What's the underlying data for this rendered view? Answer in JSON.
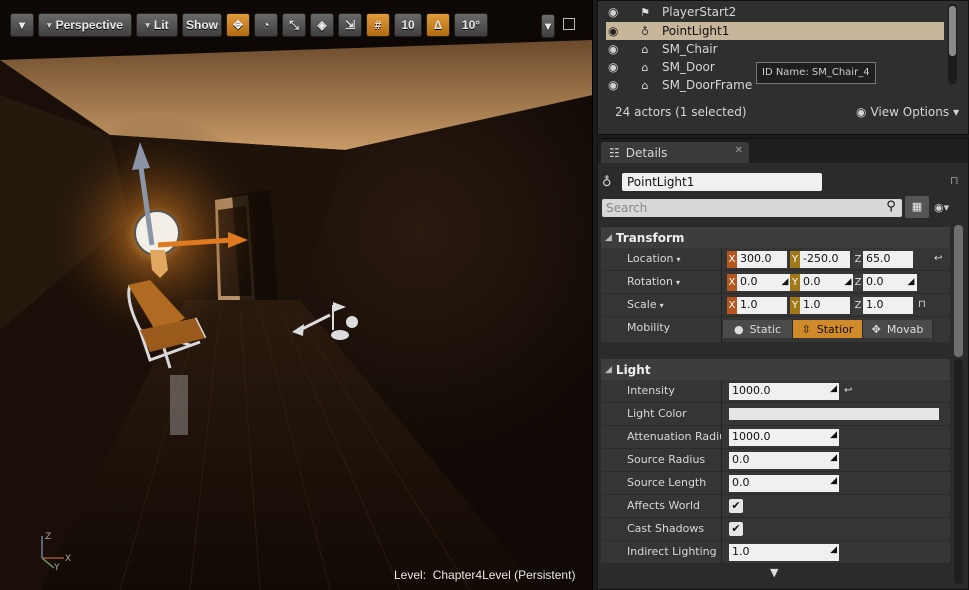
{
  "viewport": {
    "perspective_label": "Perspective",
    "lit_label": "Lit",
    "show_label": "Show",
    "grid_snap_value": "10",
    "rot_snap_value": "10°",
    "level_prefix": "Level:",
    "level_name": "Chapter4Level (Persistent)",
    "axis_z": "Z",
    "axis_x": "X",
    "axis_y": "Y"
  },
  "outliner": {
    "rows": [
      {
        "name": "PlayerStart2",
        "icon": "flag-icon",
        "selected": false
      },
      {
        "name": "PointLight1",
        "icon": "lightbulb-icon",
        "selected": true
      },
      {
        "name": "SM_Chair",
        "icon": "static-mesh-icon",
        "selected": false
      },
      {
        "name": "SM_Door",
        "icon": "static-mesh-icon",
        "selected": false
      },
      {
        "name": "SM_DoorFrame",
        "icon": "static-mesh-icon",
        "selected": false
      }
    ],
    "tooltip": "ID Name: SM_Chair_4",
    "actor_count": "24 actors (1 selected)",
    "view_options": "View Options"
  },
  "details": {
    "tab_label": "Details",
    "actor_name": "PointLight1",
    "search_placeholder": "Search",
    "transform": {
      "header": "Transform",
      "location_label": "Location",
      "rotation_label": "Rotation",
      "scale_label": "Scale",
      "mobility_label": "Mobility",
      "location": {
        "x": "300.0",
        "y": "-250.0",
        "z": "65.0"
      },
      "rotation": {
        "x": "0.0",
        "y": "0.0",
        "z": "0.0"
      },
      "scale": {
        "x": "1.0",
        "y": "1.0",
        "z": "1.0"
      },
      "axis_x": "X",
      "axis_y": "Y",
      "axis_z": "Z",
      "mobility_options": [
        "Static",
        "Statior",
        "Movab"
      ],
      "mobility_selected": "Statior"
    },
    "light": {
      "header": "Light",
      "intensity_label": "Intensity",
      "intensity": "1000.0",
      "light_color_label": "Light Color",
      "attenuation_label": "Attenuation Radius",
      "attenuation": "1000.0",
      "source_radius_label": "Source Radius",
      "source_radius": "0.0",
      "source_length_label": "Source Length",
      "source_length": "0.0",
      "affects_world_label": "Affects World",
      "affects_world": true,
      "cast_shadows_label": "Cast Shadows",
      "cast_shadows": true,
      "indirect_label": "Indirect Lighting In",
      "indirect": "1.0"
    }
  },
  "colors": {
    "accent_orange": "#d08a2a",
    "selection": "#c7b69a",
    "panel": "#2b2b2b"
  }
}
